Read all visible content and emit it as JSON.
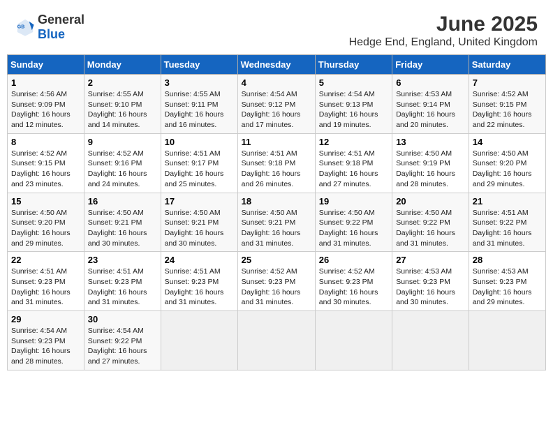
{
  "header": {
    "logo_general": "General",
    "logo_blue": "Blue",
    "month": "June 2025",
    "location": "Hedge End, England, United Kingdom"
  },
  "days_of_week": [
    "Sunday",
    "Monday",
    "Tuesday",
    "Wednesday",
    "Thursday",
    "Friday",
    "Saturday"
  ],
  "weeks": [
    [
      {
        "day": "1",
        "info": "Sunrise: 4:56 AM\nSunset: 9:09 PM\nDaylight: 16 hours\nand 12 minutes."
      },
      {
        "day": "2",
        "info": "Sunrise: 4:55 AM\nSunset: 9:10 PM\nDaylight: 16 hours\nand 14 minutes."
      },
      {
        "day": "3",
        "info": "Sunrise: 4:55 AM\nSunset: 9:11 PM\nDaylight: 16 hours\nand 16 minutes."
      },
      {
        "day": "4",
        "info": "Sunrise: 4:54 AM\nSunset: 9:12 PM\nDaylight: 16 hours\nand 17 minutes."
      },
      {
        "day": "5",
        "info": "Sunrise: 4:54 AM\nSunset: 9:13 PM\nDaylight: 16 hours\nand 19 minutes."
      },
      {
        "day": "6",
        "info": "Sunrise: 4:53 AM\nSunset: 9:14 PM\nDaylight: 16 hours\nand 20 minutes."
      },
      {
        "day": "7",
        "info": "Sunrise: 4:52 AM\nSunset: 9:15 PM\nDaylight: 16 hours\nand 22 minutes."
      }
    ],
    [
      {
        "day": "8",
        "info": "Sunrise: 4:52 AM\nSunset: 9:15 PM\nDaylight: 16 hours\nand 23 minutes."
      },
      {
        "day": "9",
        "info": "Sunrise: 4:52 AM\nSunset: 9:16 PM\nDaylight: 16 hours\nand 24 minutes."
      },
      {
        "day": "10",
        "info": "Sunrise: 4:51 AM\nSunset: 9:17 PM\nDaylight: 16 hours\nand 25 minutes."
      },
      {
        "day": "11",
        "info": "Sunrise: 4:51 AM\nSunset: 9:18 PM\nDaylight: 16 hours\nand 26 minutes."
      },
      {
        "day": "12",
        "info": "Sunrise: 4:51 AM\nSunset: 9:18 PM\nDaylight: 16 hours\nand 27 minutes."
      },
      {
        "day": "13",
        "info": "Sunrise: 4:50 AM\nSunset: 9:19 PM\nDaylight: 16 hours\nand 28 minutes."
      },
      {
        "day": "14",
        "info": "Sunrise: 4:50 AM\nSunset: 9:20 PM\nDaylight: 16 hours\nand 29 minutes."
      }
    ],
    [
      {
        "day": "15",
        "info": "Sunrise: 4:50 AM\nSunset: 9:20 PM\nDaylight: 16 hours\nand 29 minutes."
      },
      {
        "day": "16",
        "info": "Sunrise: 4:50 AM\nSunset: 9:21 PM\nDaylight: 16 hours\nand 30 minutes."
      },
      {
        "day": "17",
        "info": "Sunrise: 4:50 AM\nSunset: 9:21 PM\nDaylight: 16 hours\nand 30 minutes."
      },
      {
        "day": "18",
        "info": "Sunrise: 4:50 AM\nSunset: 9:21 PM\nDaylight: 16 hours\nand 31 minutes."
      },
      {
        "day": "19",
        "info": "Sunrise: 4:50 AM\nSunset: 9:22 PM\nDaylight: 16 hours\nand 31 minutes."
      },
      {
        "day": "20",
        "info": "Sunrise: 4:50 AM\nSunset: 9:22 PM\nDaylight: 16 hours\nand 31 minutes."
      },
      {
        "day": "21",
        "info": "Sunrise: 4:51 AM\nSunset: 9:22 PM\nDaylight: 16 hours\nand 31 minutes."
      }
    ],
    [
      {
        "day": "22",
        "info": "Sunrise: 4:51 AM\nSunset: 9:23 PM\nDaylight: 16 hours\nand 31 minutes."
      },
      {
        "day": "23",
        "info": "Sunrise: 4:51 AM\nSunset: 9:23 PM\nDaylight: 16 hours\nand 31 minutes."
      },
      {
        "day": "24",
        "info": "Sunrise: 4:51 AM\nSunset: 9:23 PM\nDaylight: 16 hours\nand 31 minutes."
      },
      {
        "day": "25",
        "info": "Sunrise: 4:52 AM\nSunset: 9:23 PM\nDaylight: 16 hours\nand 31 minutes."
      },
      {
        "day": "26",
        "info": "Sunrise: 4:52 AM\nSunset: 9:23 PM\nDaylight: 16 hours\nand 30 minutes."
      },
      {
        "day": "27",
        "info": "Sunrise: 4:53 AM\nSunset: 9:23 PM\nDaylight: 16 hours\nand 30 minutes."
      },
      {
        "day": "28",
        "info": "Sunrise: 4:53 AM\nSunset: 9:23 PM\nDaylight: 16 hours\nand 29 minutes."
      }
    ],
    [
      {
        "day": "29",
        "info": "Sunrise: 4:54 AM\nSunset: 9:23 PM\nDaylight: 16 hours\nand 28 minutes."
      },
      {
        "day": "30",
        "info": "Sunrise: 4:54 AM\nSunset: 9:22 PM\nDaylight: 16 hours\nand 27 minutes."
      },
      {
        "day": "",
        "info": ""
      },
      {
        "day": "",
        "info": ""
      },
      {
        "day": "",
        "info": ""
      },
      {
        "day": "",
        "info": ""
      },
      {
        "day": "",
        "info": ""
      }
    ]
  ]
}
